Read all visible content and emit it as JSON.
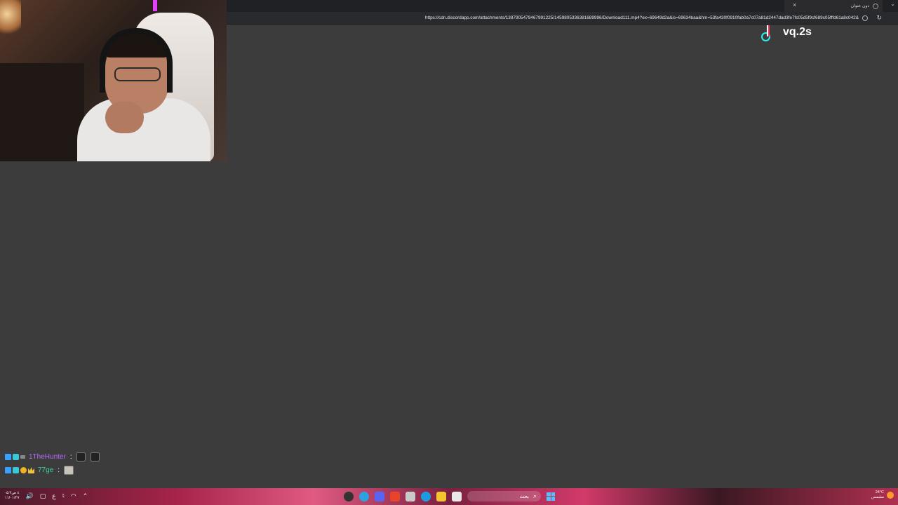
{
  "browser": {
    "tab_title": "دون عنوان",
    "new_tab_label": "+",
    "close_tab_label": "×",
    "menu_label": "⌄",
    "url": "https://cdn.discordapp.com/attachments/1387905479467991225/1459805336381689996/Download111.mp4?ex=69649d2a&is=69634baa&hm=53fa430f0910fab0a7c07a81d2447dad3fe7fc05d5f9cf689c05fffd61a8c042&",
    "reload_label": "↻"
  },
  "watermark": {
    "icon": "tiktok-icon",
    "handle": "vq.2s"
  },
  "chat": [
    {
      "username": "1TheHunter",
      "color": "#b26bff",
      "separator": ":"
    },
    {
      "username": "77ge",
      "color": "#3bd39a",
      "separator": ":"
    }
  ],
  "taskbar": {
    "clock_time": "۰۵:۲٤ ص",
    "clock_date": "۱۱/۰۱/۲۷",
    "volume_icon": "🔊",
    "search_placeholder": "بحث",
    "weather_temp": "24°C",
    "weather_status": "مشمس",
    "colors": {
      "windows_accent": "#4fc3ff"
    }
  }
}
